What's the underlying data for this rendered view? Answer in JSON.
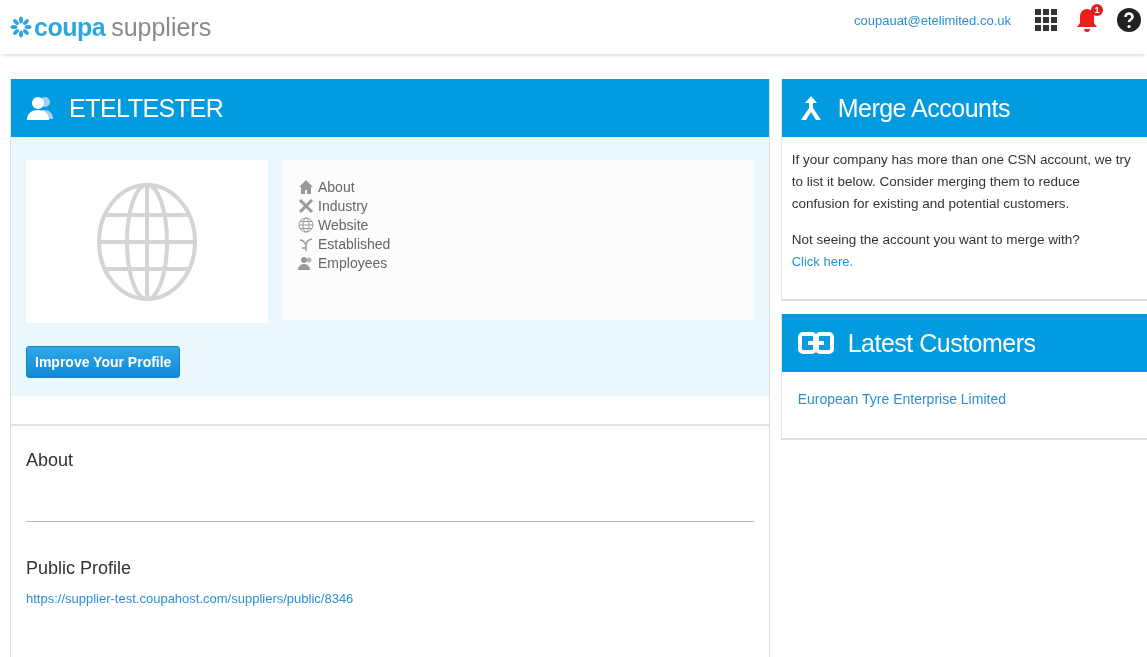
{
  "header": {
    "logo_brand": "coupa",
    "logo_product": "suppliers",
    "user_email": "coupauat@etelimited.co.uk",
    "notification_count": "1"
  },
  "profile": {
    "name": "ETELTESTER",
    "facts": [
      {
        "kind": "home",
        "label": "About"
      },
      {
        "kind": "tools",
        "label": "Industry"
      },
      {
        "kind": "globe",
        "label": "Website"
      },
      {
        "kind": "branch",
        "label": "Established"
      },
      {
        "kind": "people",
        "label": "Employees"
      }
    ],
    "improve_button": "Improve Your Profile",
    "about_heading": "About",
    "public_profile_heading": "Public Profile",
    "public_profile_url": "https://supplier-test.coupahost.com/suppliers/public/8346"
  },
  "merge_accounts": {
    "title": "Merge Accounts",
    "description": "If your company has more than one CSN account, we try to list it below. Consider merging them to reduce confusion for existing and potential customers.",
    "prompt": "Not seeing the account you want to merge with?",
    "link": "Click here."
  },
  "latest_customers": {
    "title": "Latest Customers",
    "customers": [
      "European Tyre Enterprise Limited"
    ]
  }
}
